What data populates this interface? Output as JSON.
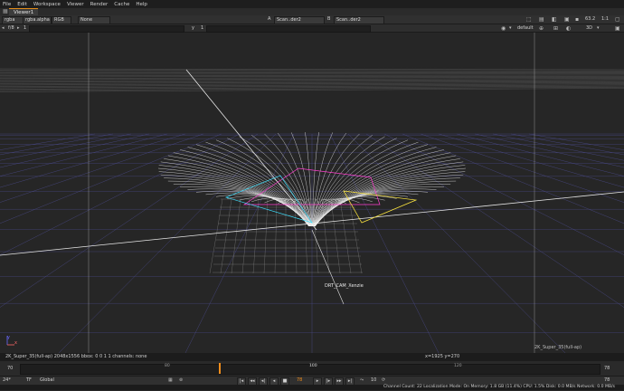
{
  "menu": [
    "File",
    "Edit",
    "Workspace",
    "Viewer",
    "Render",
    "Cache",
    "Help"
  ],
  "tab": {
    "label": "Viewer1"
  },
  "controls": {
    "channels": "rgba",
    "alpha": "rgba.alpha",
    "colorspace": "RGB",
    "lut": "None",
    "input_a_letter": "A",
    "input_a": "Scan..der2",
    "input_b_letter": "B",
    "input_b": "Scan..der2",
    "zoom": "63.2",
    "ratio": "1:1",
    "fstop_label": "f/8",
    "gain_value": "1",
    "y_label": "y",
    "gamma_value": "1",
    "camera": "default",
    "view_mode": "3D"
  },
  "viewport": {
    "camera_label": "DRT_CAM_Xenzie",
    "format_left": "2K_Super_35(full-ap)",
    "axis_y": "y",
    "axis_x": "x"
  },
  "info": {
    "format": "2K_Super_35(full-ap) 2048x1556  bbox: 0 0 1 1 channels: none",
    "coords": "x=1925 y=270"
  },
  "timeline": {
    "start": "70",
    "end": "78",
    "current": "78",
    "ticks": [
      "80",
      "100",
      "100",
      "100",
      "120"
    ],
    "tick_positions": [
      80,
      100,
      100,
      100,
      120
    ]
  },
  "playback": {
    "fps": "24*",
    "tf": "TF",
    "mode": "Global",
    "frame": "78",
    "step": "10",
    "end_frame": "78"
  },
  "status": {
    "text": "Channel Count: 22  Localization Mode: On  Memory: 1.8 GB (11.4%)  CPU: 1.5%  Disk: 0.0 MB/s  Network: 0.0 MB/s"
  },
  "colors": {
    "accent": "#f08d1c",
    "bg": "#262626",
    "grid": "#6a6a6a",
    "ground": "#4b4b8c"
  }
}
